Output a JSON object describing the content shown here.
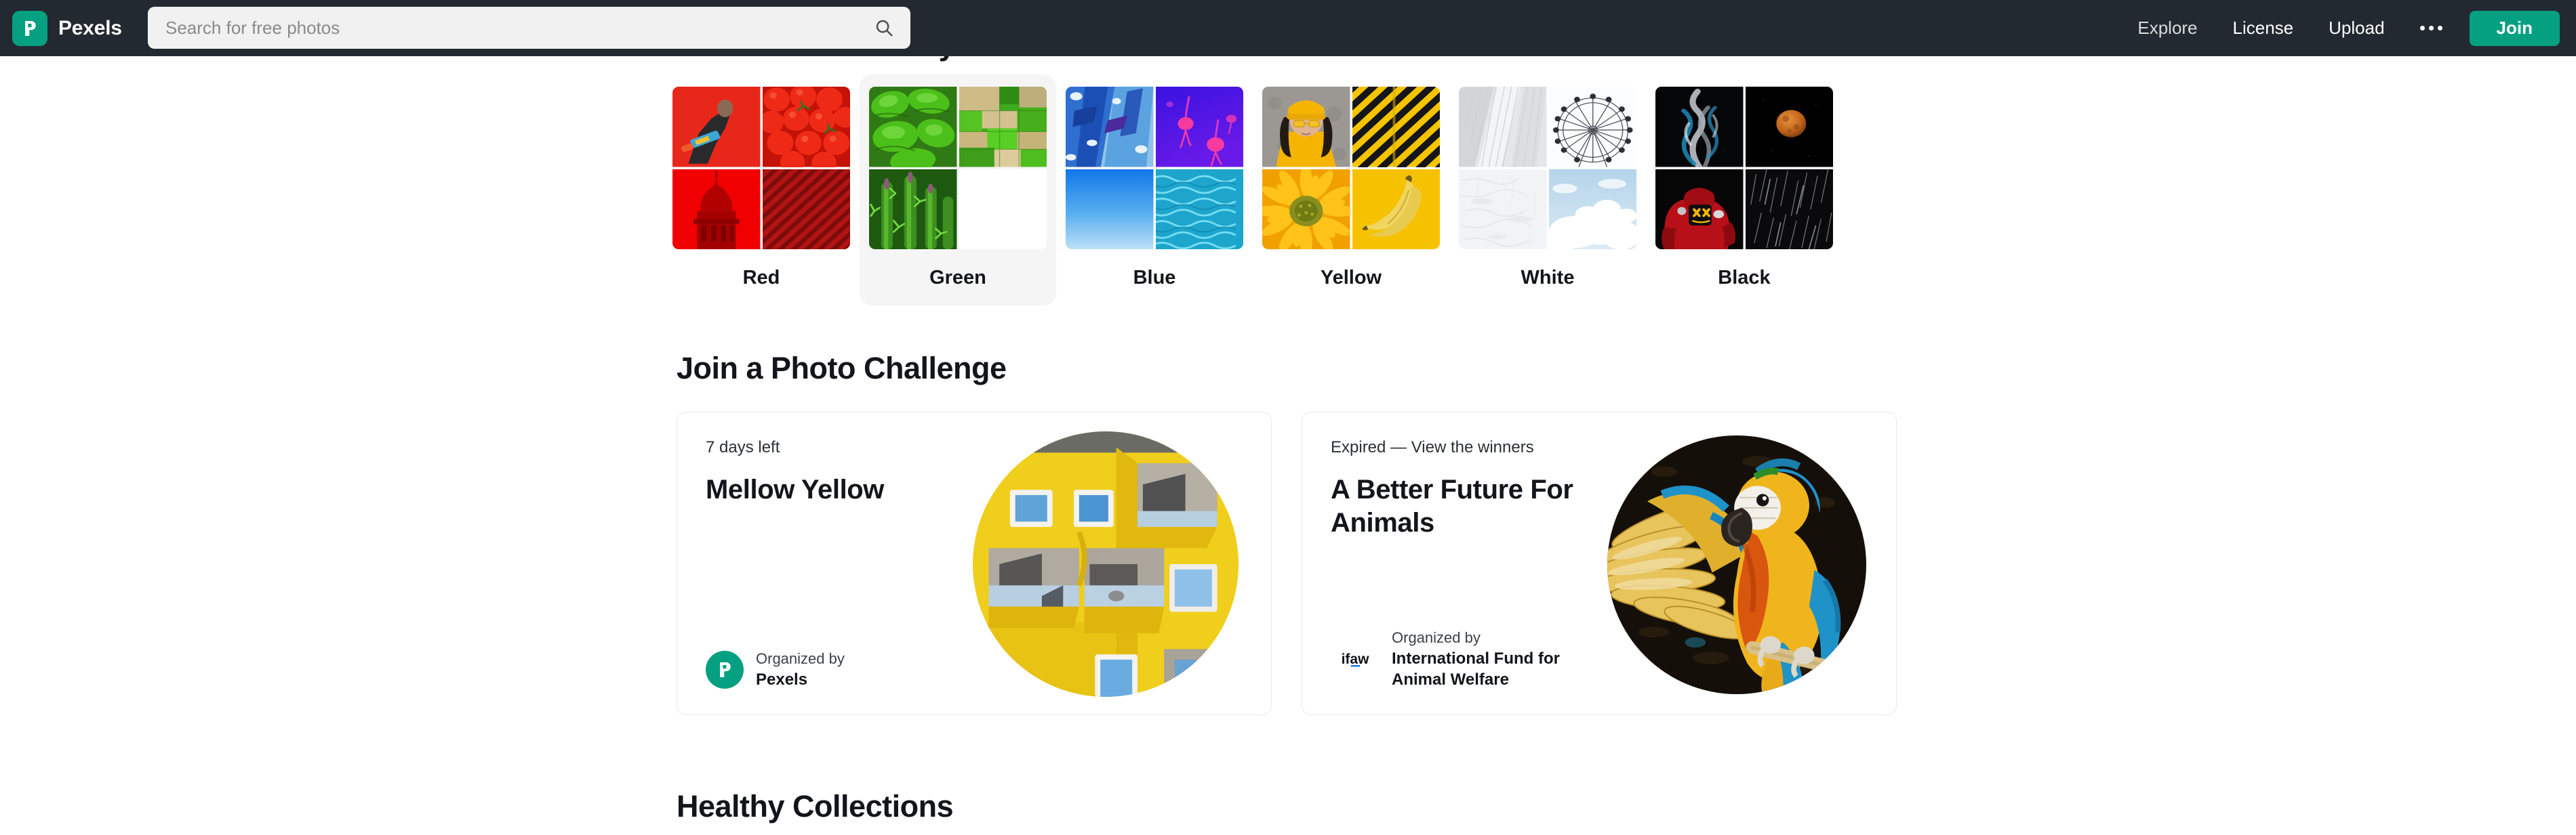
{
  "header": {
    "brand_name": "Pexels",
    "logo_icon": "pexels-p-logo",
    "search": {
      "placeholder": "Search for free photos",
      "value": "",
      "icon": "search-icon"
    },
    "nav": [
      {
        "label": "Explore",
        "bright": false
      },
      {
        "label": "License",
        "bright": true
      },
      {
        "label": "Upload",
        "bright": true
      }
    ],
    "more_icon": "ellipsis-icon",
    "join_label": "Join",
    "brand_color": "#05a081",
    "bar_color": "#232931"
  },
  "discover": {
    "title": "Discover Photos by Color",
    "colors": [
      {
        "label": "Red",
        "hovered": false,
        "tiles": [
          "red-chainsaw-man",
          "red-tomatoes",
          "red-dome-building",
          "red-diagonal-stripes"
        ]
      },
      {
        "label": "Green",
        "hovered": true,
        "tiles": [
          "green-lettuce-leaves",
          "green-aerial-fields",
          "green-cactus-plants",
          "empty"
        ]
      },
      {
        "label": "Blue",
        "hovered": false,
        "tiles": [
          "blue-paint-texture",
          "blue-jellyfish",
          "blue-sky-gradient",
          "blue-pool-water"
        ]
      },
      {
        "label": "Yellow",
        "hovered": false,
        "tiles": [
          "yellow-beanie-woman",
          "yellow-hazard-stripes",
          "yellow-sunflower",
          "yellow-bananas"
        ]
      },
      {
        "label": "White",
        "hovered": false,
        "tiles": [
          "white-architecture",
          "white-ferris-wheel",
          "white-plaster-wall",
          "white-clouds-sky"
        ]
      },
      {
        "label": "Black",
        "hovered": false,
        "tiles": [
          "black-smoke",
          "black-blood-moon",
          "black-red-hoodie",
          "black-rain-streaks"
        ]
      }
    ]
  },
  "challenge": {
    "title": "Join a Photo Challenge",
    "cards": [
      {
        "status": "7 days left",
        "name": "Mellow Yellow",
        "organized_by_label": "Organized by",
        "organizer": "Pexels",
        "organizer_logo": "pexels-circle-avatar",
        "photo": "yellow-building-facade"
      },
      {
        "status": "Expired — View the winners",
        "name": "A Better Future For Animals",
        "organized_by_label": "Organized by",
        "organizer": "International Fund for Animal Welfare",
        "organizer_logo": "ifaw-wordmark",
        "organizer_logo_text": "ifaw",
        "photo": "blue-gold-macaw"
      }
    ]
  },
  "healthy": {
    "title": "Healthy Collections"
  }
}
